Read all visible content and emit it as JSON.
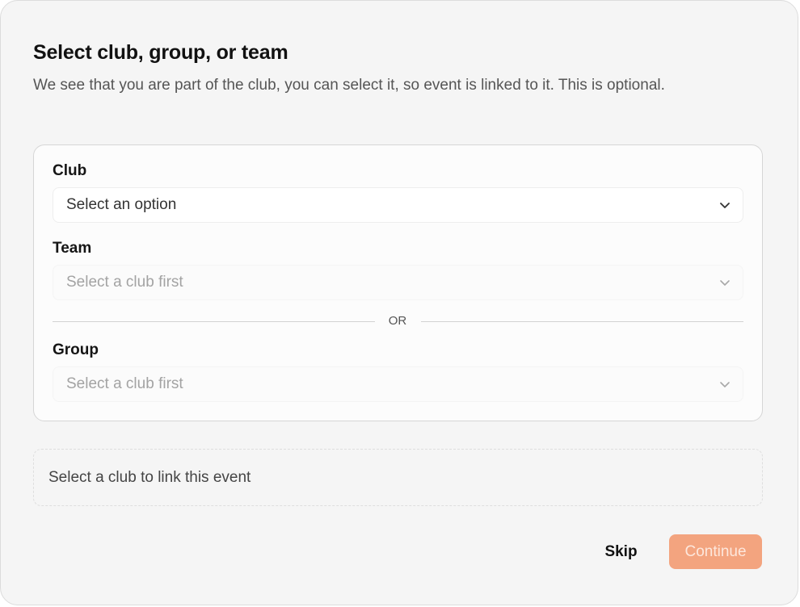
{
  "dialog": {
    "title": "Select club, group, or team",
    "subtitle": "We see that you are part of the club, you can select it, so event is linked to it. This is optional."
  },
  "form": {
    "club": {
      "label": "Club",
      "value": "Select an option",
      "enabled": true
    },
    "team": {
      "label": "Team",
      "value": "Select a club first",
      "enabled": false
    },
    "divider_text": "OR",
    "group": {
      "label": "Group",
      "value": "Select a club first",
      "enabled": false
    }
  },
  "info": {
    "text": "Select a club to link this event"
  },
  "actions": {
    "skip_label": "Skip",
    "continue_label": "Continue",
    "continue_enabled": false
  },
  "icons": {
    "dropdown": "chevron-down-icon"
  },
  "colors": {
    "accent": "#f3a47f",
    "background": "#f5f5f5"
  }
}
